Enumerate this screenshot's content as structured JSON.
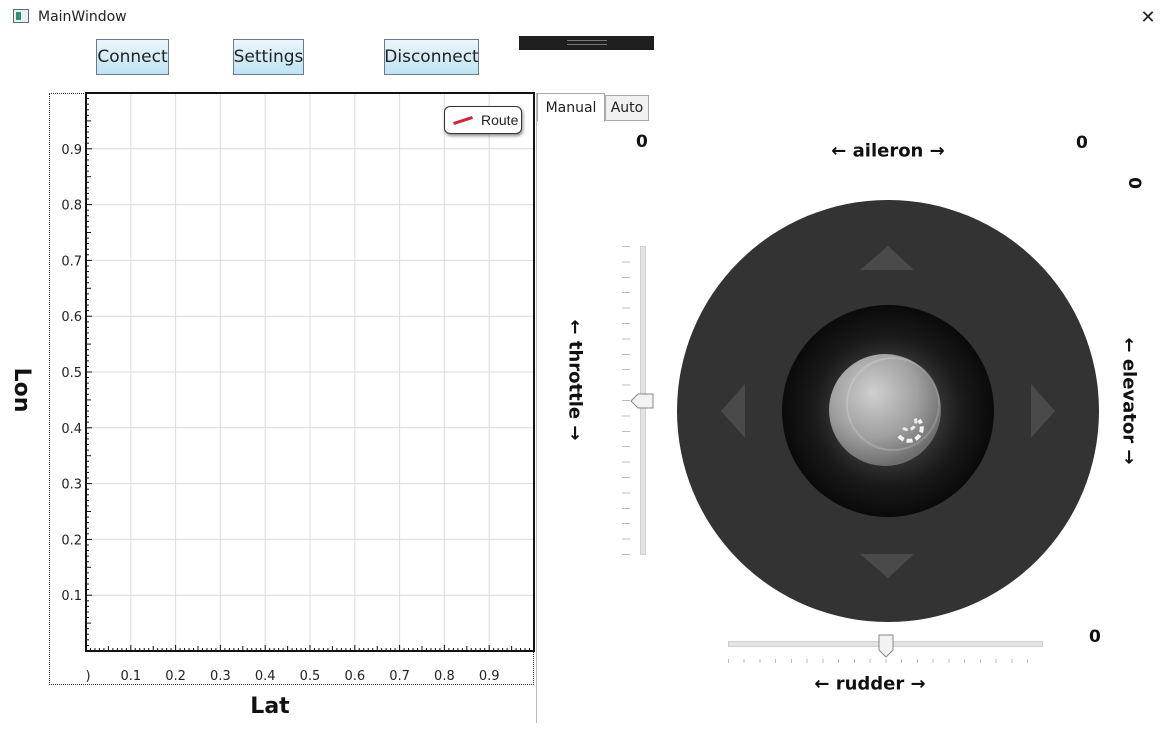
{
  "window": {
    "title": "MainWindow",
    "close_glyph": "✕"
  },
  "toolbar": {
    "connect_label": "Connect",
    "settings_label": "Settings",
    "disconnect_label": "Disconnect"
  },
  "plot": {
    "legend": "Route",
    "xlabel": "Lat",
    "ylabel": "Lon",
    "x_ticks": [
      ")",
      "0.1",
      "0.2",
      "0.3",
      "0.4",
      "0.5",
      "0.6",
      "0.7",
      "0.8",
      "0.9"
    ],
    "y_ticks": [
      "0.9",
      "0.8",
      "0.7",
      "0.6",
      "0.5",
      "0.4",
      "0.3",
      "0.2",
      "0.1"
    ],
    "colors": {
      "route": "#d0253a",
      "grid": "#dcdcdc"
    }
  },
  "tabs": [
    {
      "label": "Manual",
      "active": true
    },
    {
      "label": "Auto",
      "active": false
    }
  ],
  "controls": {
    "throttle_label": "← throttle →",
    "aileron_label": "← aileron →",
    "elevator_label": "← elevator →",
    "rudder_label": "← rudder →",
    "throttle_value": "0",
    "aileron_value": "0",
    "elevator_value": "0",
    "rudder_value": "0",
    "throttle_position": 0.5,
    "rudder_position": 0.5
  },
  "joystick": {
    "colors": {
      "outer": "#333333",
      "inner": "#111111",
      "arrow": "#4a4a4a",
      "knob": "#a8a8a8"
    }
  }
}
